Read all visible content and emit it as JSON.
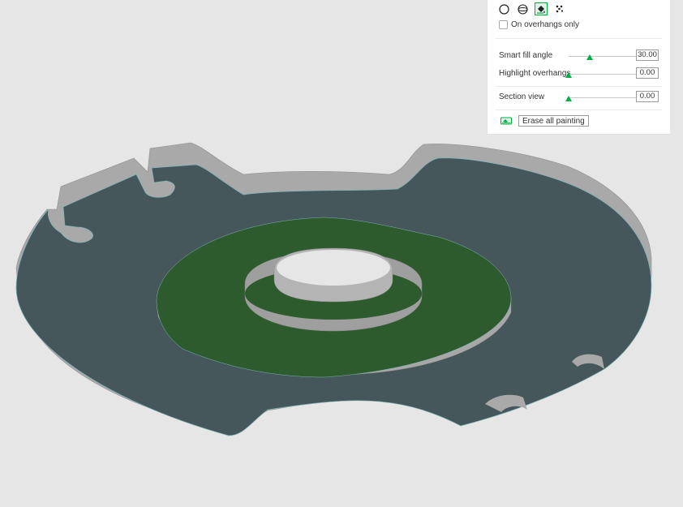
{
  "viewport": {
    "colors": {
      "background": "#e6e6e6",
      "plate_top": "#45575a",
      "plate_side": "#a8a8a8",
      "painted_region": "#2e5b2d"
    }
  },
  "paint_panel": {
    "tools": [
      {
        "name": "circle-tool-icon",
        "active": false
      },
      {
        "name": "sphere-tool-icon",
        "active": false
      },
      {
        "name": "fill-tool-icon",
        "active": true
      },
      {
        "name": "gap-fill-tool-icon",
        "active": false
      }
    ],
    "overhangs_only": {
      "label": "On overhangs only",
      "checked": false
    },
    "smart_fill_angle": {
      "label": "Smart fill angle",
      "value": "30.00",
      "fraction": 0.3
    },
    "highlight_overhangs": {
      "label": "Highlight overhangs",
      "value": "0.00",
      "fraction": 0.0
    },
    "section_view": {
      "label": "Section view",
      "value": "0.00",
      "fraction": 0.0
    },
    "erase_all": {
      "label": "Erase all painting",
      "icon": "eraser-icon"
    },
    "colors": {
      "accent": "#00ae42"
    }
  }
}
